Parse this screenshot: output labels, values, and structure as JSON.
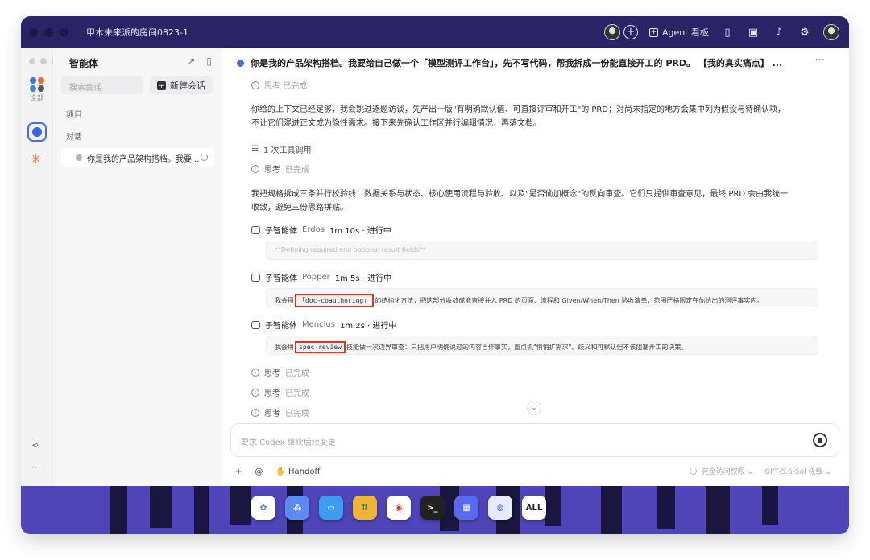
{
  "topbar": {
    "room_title": "甲木未来派的房间0823-1",
    "agent_board_label": "Agent 看板"
  },
  "sidebar": {
    "title": "智能体",
    "search_placeholder": "搜索会话",
    "new_chat_label": "新建会话",
    "section_projects": "项目",
    "section_chats": "对话",
    "conversation_item": "你是我的产品架构搭档。我要...",
    "rail_all_label": "全部"
  },
  "main": {
    "header_title": "你是我的产品架构搭档。我要给自己做一个「模型测评工作台」，先不写代码，帮我拆成一份能直接开工的 PRD。 【我的真实痛点】 ...",
    "top_status": "思考 已完成",
    "para1": "你给的上下文已经足够，我会跳过逐题访谈，先产出一版\"有明确默认值、可直接评审和开工\"的 PRD；对尚未指定的地方会集中列为假设与待确认项，不让它们混进正文成为隐性需求。接下来先确认工作区并行编辑情况，再落文档。",
    "tool_calls": "1 次工具调用",
    "think_label": "思考",
    "think_done": "已完成",
    "para2": "我把规格拆成三条并行校验线：数据关系与状态、核心使用流程与验收、以及\"是否偷加概念\"的反向审查。它们只提供审查意见，最终 PRD 会由我统一收敛，避免三份思路拼贴。",
    "subagent_label": "子智能体",
    "subagents": [
      {
        "name": "Erdos",
        "status": "1m 10s · 进行中",
        "card": "**Defining required and optional result fields**"
      },
      {
        "name": "Popper",
        "status": "1m 5s · 进行中",
        "card_pre": "我会用",
        "card_tag": "「doc-coauthoring」",
        "card_post": "的结构化方法，把这部分收敛成能直接并入 PRD 的页面、流程和 Given/When/Then 验收清单，范围严格限定在你给出的测评事实内。"
      },
      {
        "name": "Mencius",
        "status": "1m 2s · 进行中",
        "card_pre": "我会用",
        "card_tag": "spec-review",
        "card_post": "技能做一次边界审查：只把用户明确说过的内容当作事实，重点抓\"悄悄扩需求\"、歧义和可默认但不该阻塞开工的决策。"
      }
    ],
    "composer_placeholder": "要求 Codex 继续后续变更",
    "handoff_label": "Handoff",
    "access_label": "完全访问权限",
    "model_label": "GPT-5.6-Sol 极致"
  },
  "dock": {
    "all_label": "ALL"
  },
  "colors": {
    "accent": "#4a6ee0",
    "highlight_border": "#d9361e",
    "window_bg": "#3a3385"
  }
}
